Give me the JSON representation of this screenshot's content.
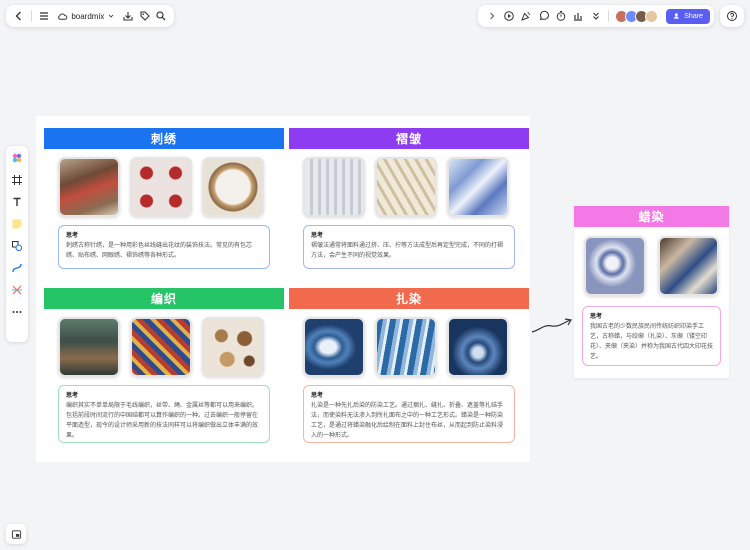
{
  "topbar": {
    "brand": "boardmix",
    "share_label": "Share",
    "avatar_colors": [
      "#c96f5a",
      "#6b8cff",
      "#7a5c4a",
      "#e6c8a0"
    ]
  },
  "cards": [
    {
      "title": "刺绣",
      "color": "#1a73f0",
      "note_border": "#9ab7f7",
      "note_label": "思考",
      "note_text": "刺绣古称针绣，是一种用彩色丝线缝出花纹的装饰技法。常见的有包芯绣、贴布绣、网眼绣、褶饰绣等各种形式。"
    },
    {
      "title": "褶皱",
      "color": "#8e3cf2",
      "note_border": "#a7b6ea",
      "note_label": "思考",
      "note_text": "褶皱法通常将面料通过挤、压、拧等方法成型后再定型完成，不同的打褶方法，会产生不同的视觉效果。"
    },
    {
      "title": "编织",
      "color": "#24c467",
      "note_border": "#9fe0bd",
      "note_label": "思考",
      "note_text": "编织其实不单单局限于毛线编织，丝带、绳、金属丝等都可以用来编织。包括前段时间流行的中国结都可以算作编织的一种。过去编织一般停留在平面造型，现今的设计师采用新的技法同样可以将编织做出立体丰满的效果。"
    },
    {
      "title": "扎染",
      "color": "#f26a4e",
      "note_border": "#f6b3a3",
      "note_label": "思考",
      "note_text": "扎染是一种先扎后染的防染工艺。通过捆扎、缝扎、折叠、遮盖等扎结手法，而使染料无法渗入到所扎面布之中的一种工艺形式。蜡染是一种防染工艺，是通过将蜡染融化后绘制在面料上封住布丝，从而起到防止染料浸入的一种形式。"
    },
    {
      "title": "蜡染",
      "color": "#f37ae6",
      "note_border": "#f3a8ea",
      "note_label": "思考",
      "note_text": "我国古老的少数民族民间传统纺织印染手工艺，古称蜡，与绞缬（扎染）、灰缬（镂空印花）、夹缬（夹染）并称为我国古代四大印花技艺。"
    }
  ]
}
